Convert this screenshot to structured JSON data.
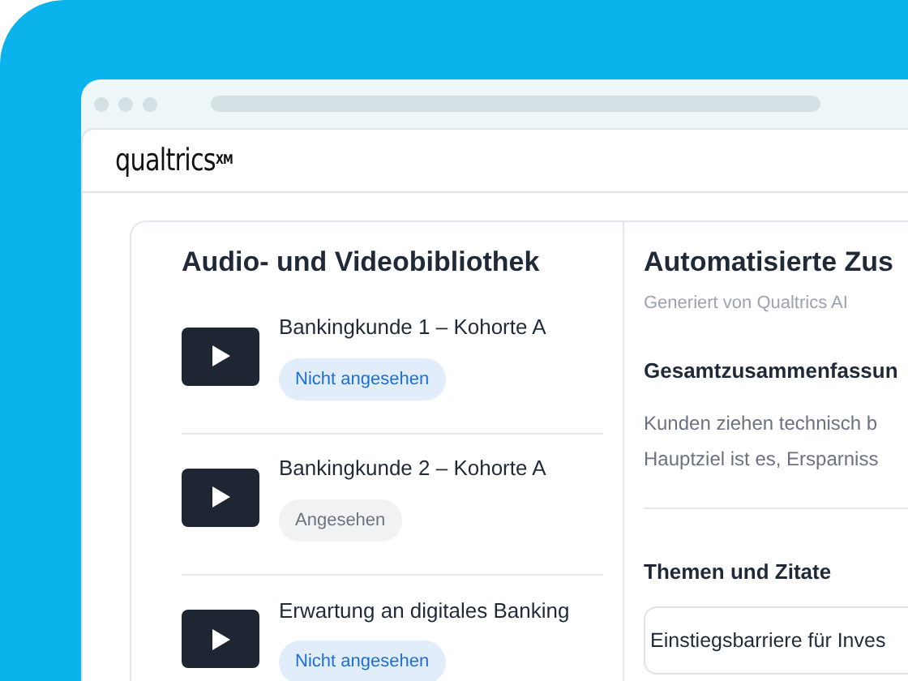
{
  "logo": "qualtrics$^{XM}$",
  "library": {
    "title": "Audio- und Videobibliothek",
    "items": [
      {
        "title": "Bankingkunde 1 – Kohorte A",
        "status": "Nicht angesehen",
        "watched": false
      },
      {
        "title": "Bankingkunde 2 – Kohorte A",
        "status": "Angesehen",
        "watched": true
      },
      {
        "title": "Erwartung an digitales Banking",
        "status": "Nicht angesehen",
        "watched": false
      }
    ]
  },
  "summary": {
    "title": "Automatisierte Zus",
    "subtitle": "Generiert von Qualtrics AI",
    "section_title": "Gesamtzusammenfassun",
    "lines": [
      "Kunden ziehen technisch b",
      "Hauptziel ist es, Ersparniss"
    ],
    "themes_title": "Themen und Zitate",
    "theme": "Einstiegsbarriere für Inves"
  }
}
